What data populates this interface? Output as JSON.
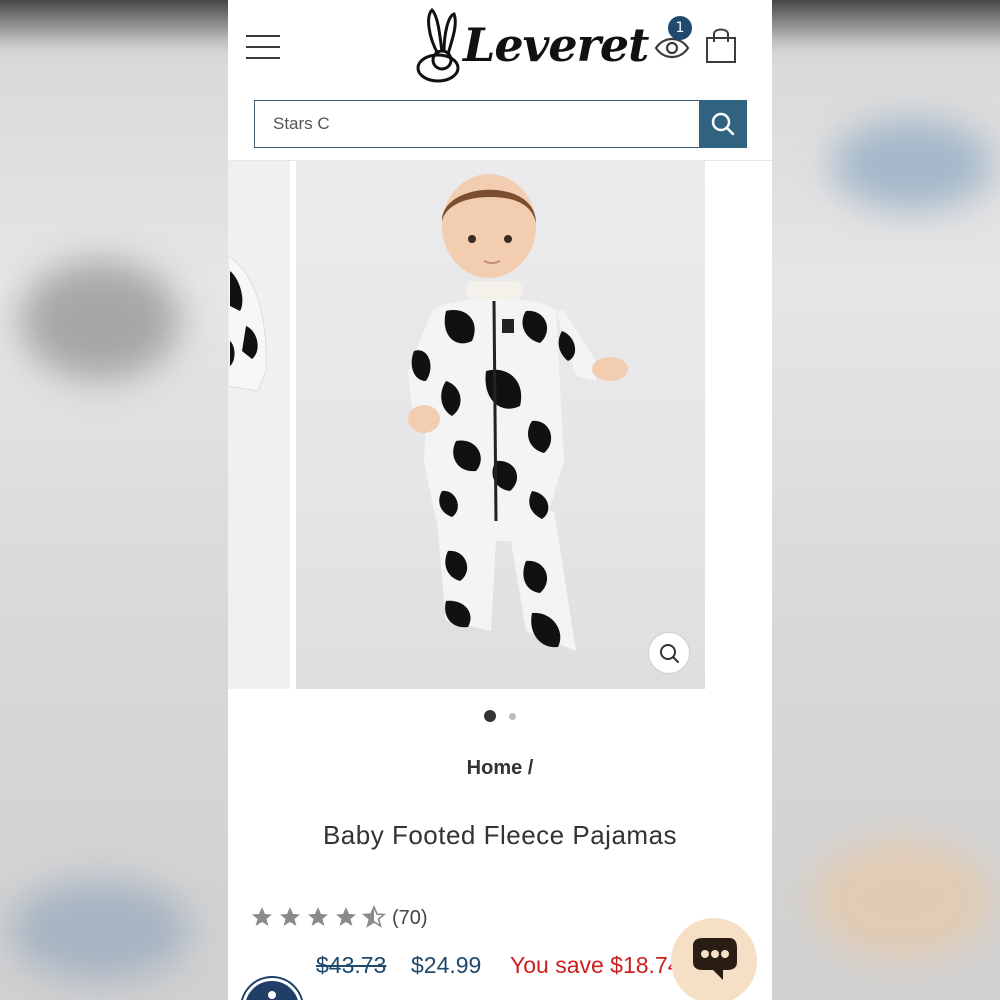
{
  "header": {
    "logo_text": "Leveret",
    "watch_badge_count": "1"
  },
  "search": {
    "value": "Stars C"
  },
  "gallery": {
    "slide_count": 2,
    "active_slide": 1
  },
  "breadcrumb": {
    "home": "Home /"
  },
  "product": {
    "title": "Baby Footed Fleece Pajamas",
    "rating": 4.5,
    "review_count": "(70)",
    "price_old": "$43.73",
    "price_new": "$24.99",
    "price_save": "You save $18.74"
  },
  "colors": {
    "accent": "#2f6380",
    "price_blue": "#1f4a6e",
    "save_red": "#cc1f1f",
    "chat_bg": "#f5dfc5"
  },
  "icons": [
    "menu-icon",
    "eye-icon",
    "shopping-bag-icon",
    "search-icon",
    "zoom-icon",
    "star-icon",
    "chat-icon",
    "accessibility-icon"
  ]
}
